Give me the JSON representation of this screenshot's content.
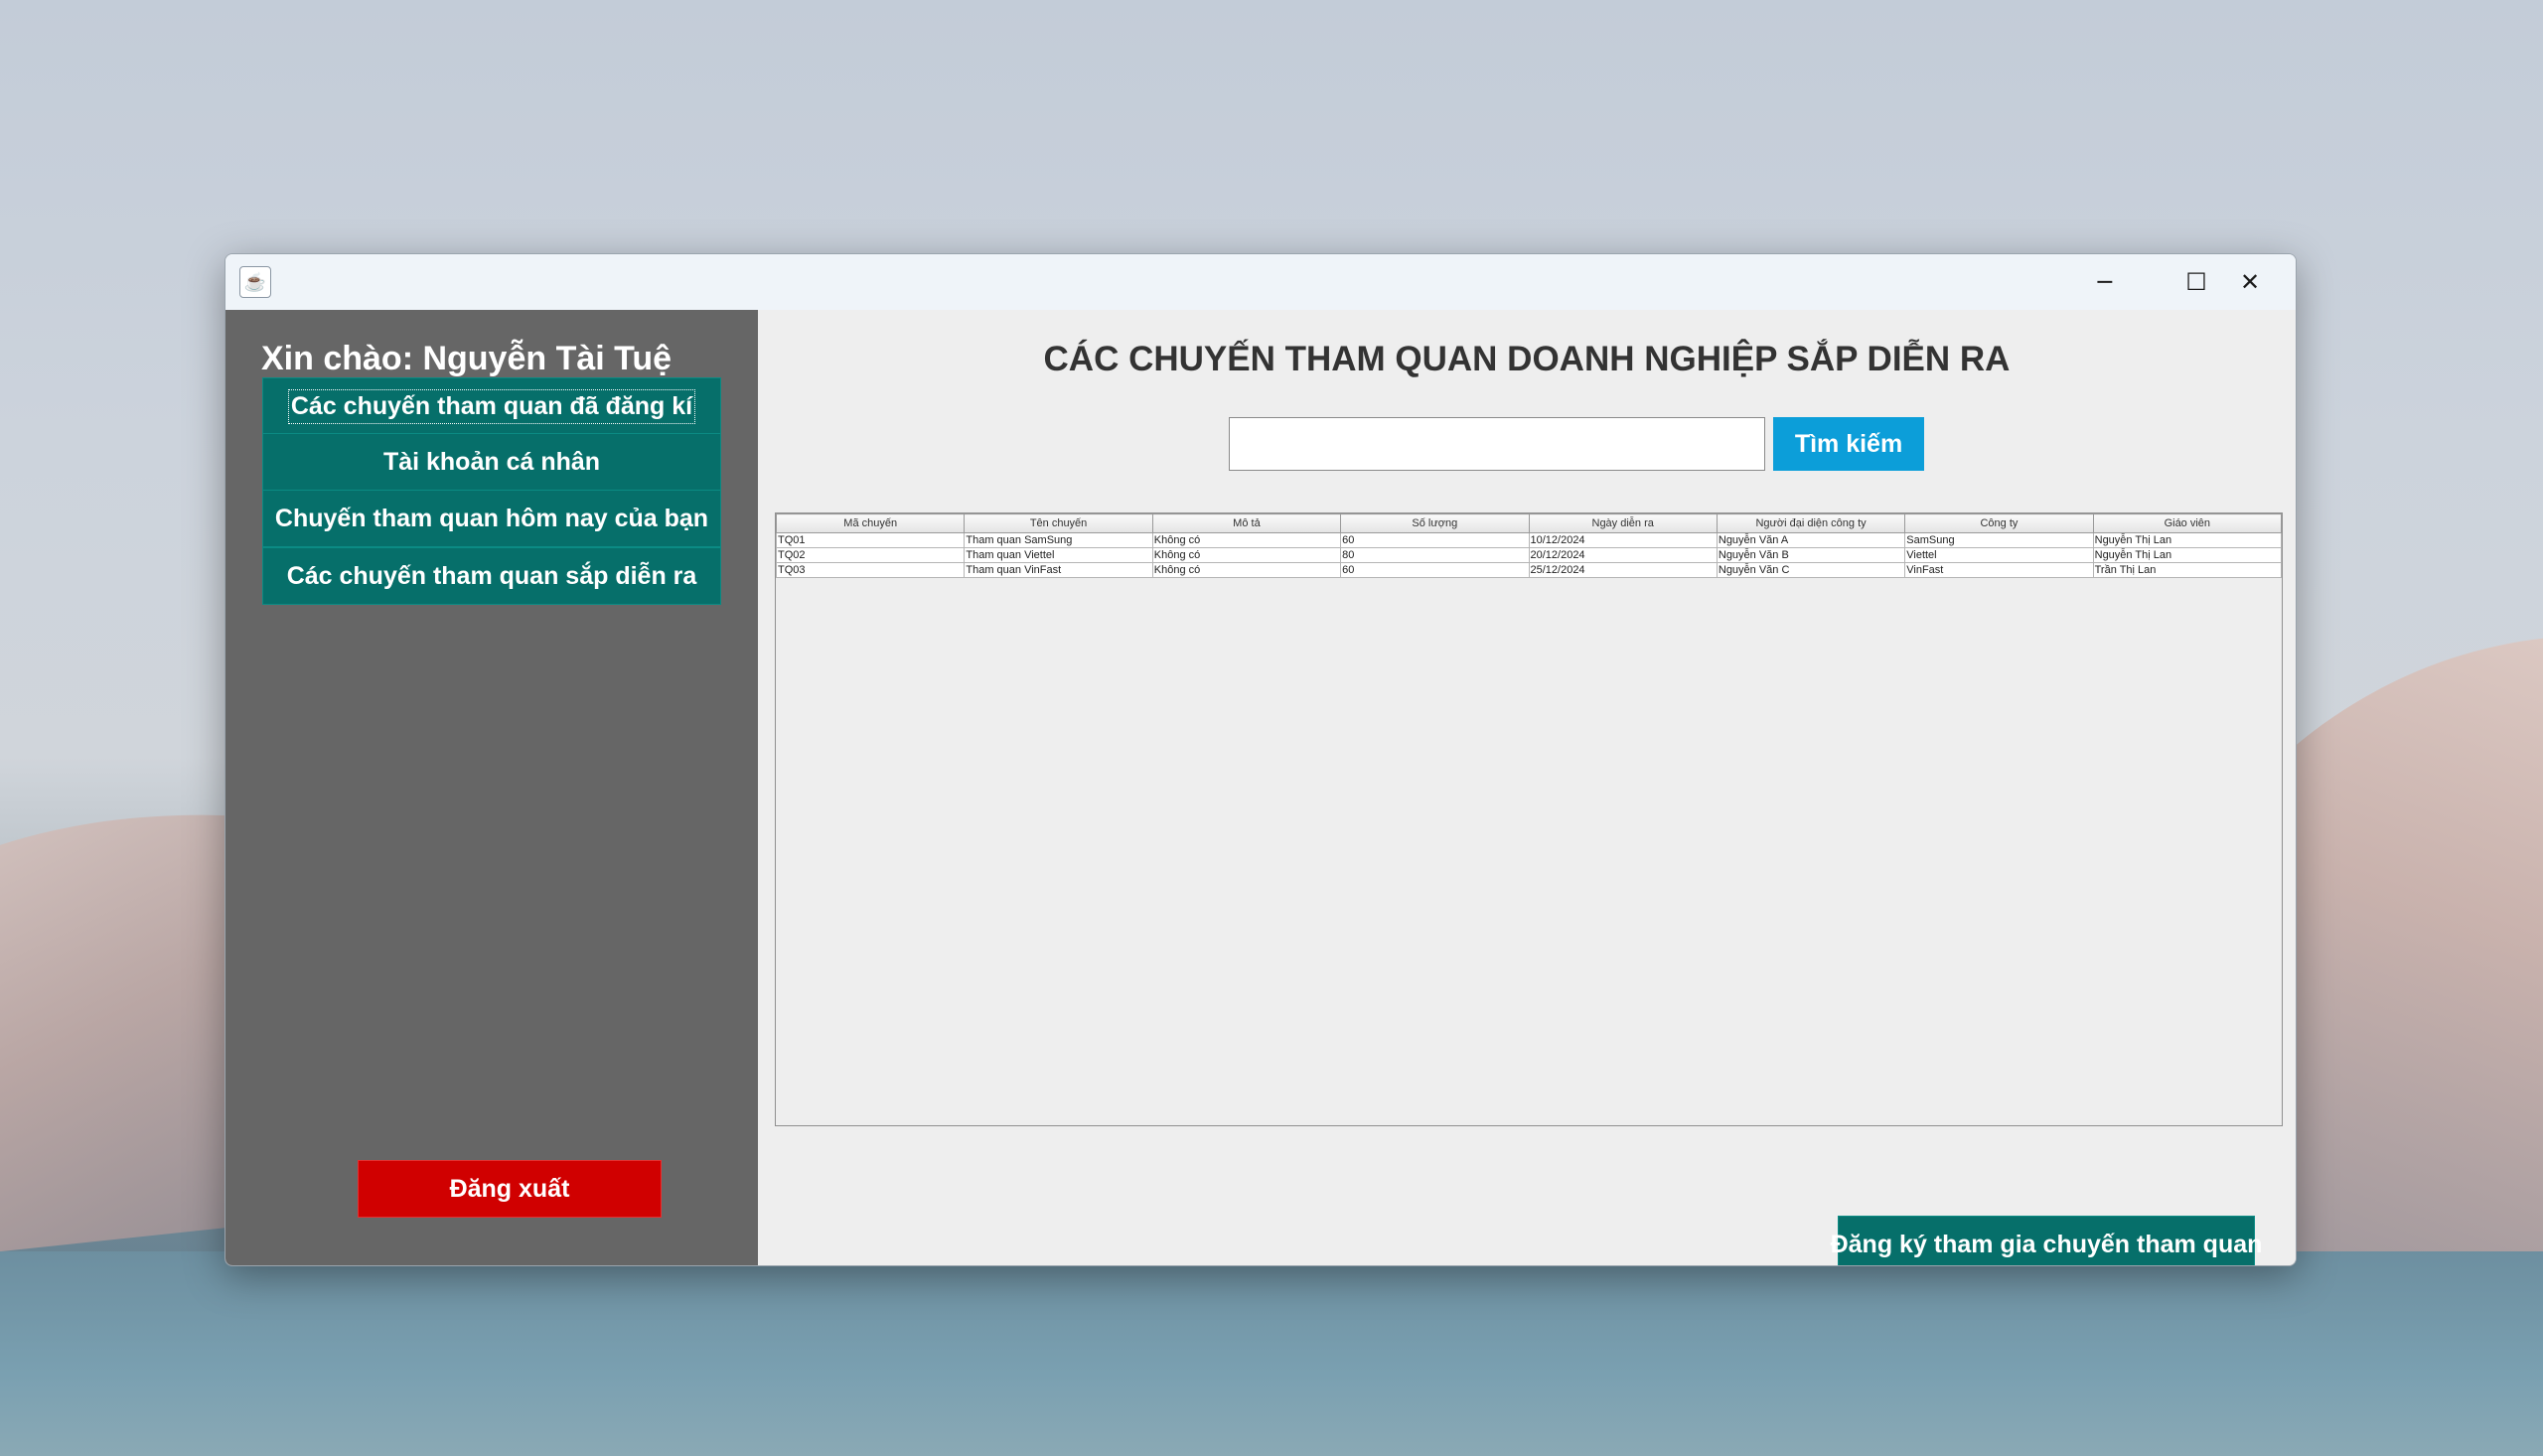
{
  "window": {
    "app_icon": "java-cup-icon",
    "controls": [
      "minimize-icon",
      "maximize-icon",
      "close-icon"
    ]
  },
  "sidebar": {
    "greeting": "Xin chào: Nguyễn Tài Tuệ",
    "items": [
      {
        "label": "Các chuyến tham quan đã đăng kí"
      },
      {
        "label": "Tài khoản cá nhân"
      },
      {
        "label": "Chuyến tham quan hôm nay của bạn"
      },
      {
        "label": "Các chuyến tham quan sắp diễn ra"
      }
    ],
    "logout_label": "Đăng xuất"
  },
  "main": {
    "title": "CÁC CHUYẾN THAM QUAN DOANH NGHIỆP SẮP DIỄN RA",
    "search": {
      "value": "",
      "button_label": "Tìm kiếm"
    },
    "table": {
      "columns": [
        "Mã chuyến",
        "Tên chuyến",
        "Mô tả",
        "Số lượng",
        "Ngày  diễn ra",
        "Người đại diện công ty",
        "Công ty",
        "Giáo viên"
      ],
      "rows": [
        [
          "TQ01",
          "Tham quan SamSung",
          "Không có",
          "60",
          "10/12/2024",
          "Nguyễn Văn A",
          "SamSung",
          "Nguyễn Thị Lan"
        ],
        [
          "TQ02",
          "Tham quan Viettel",
          "Không có",
          "80",
          "20/12/2024",
          "Nguyễn Văn B",
          "Viettel",
          "Nguyễn Thị Lan"
        ],
        [
          "TQ03",
          "Tham quan VinFast",
          "Không có",
          "60",
          "25/12/2024",
          "Nguyễn Văn C",
          "VinFast",
          "Trần Thị Lan"
        ]
      ]
    },
    "register_label": "Đăng ký tham gia chuyến tham quan"
  },
  "colors": {
    "sidebar_bg": "#666666",
    "nav_button": "#066f6a",
    "logout_button": "#d00000",
    "search_button": "#0c9ed9",
    "content_bg": "#eeeeee"
  }
}
